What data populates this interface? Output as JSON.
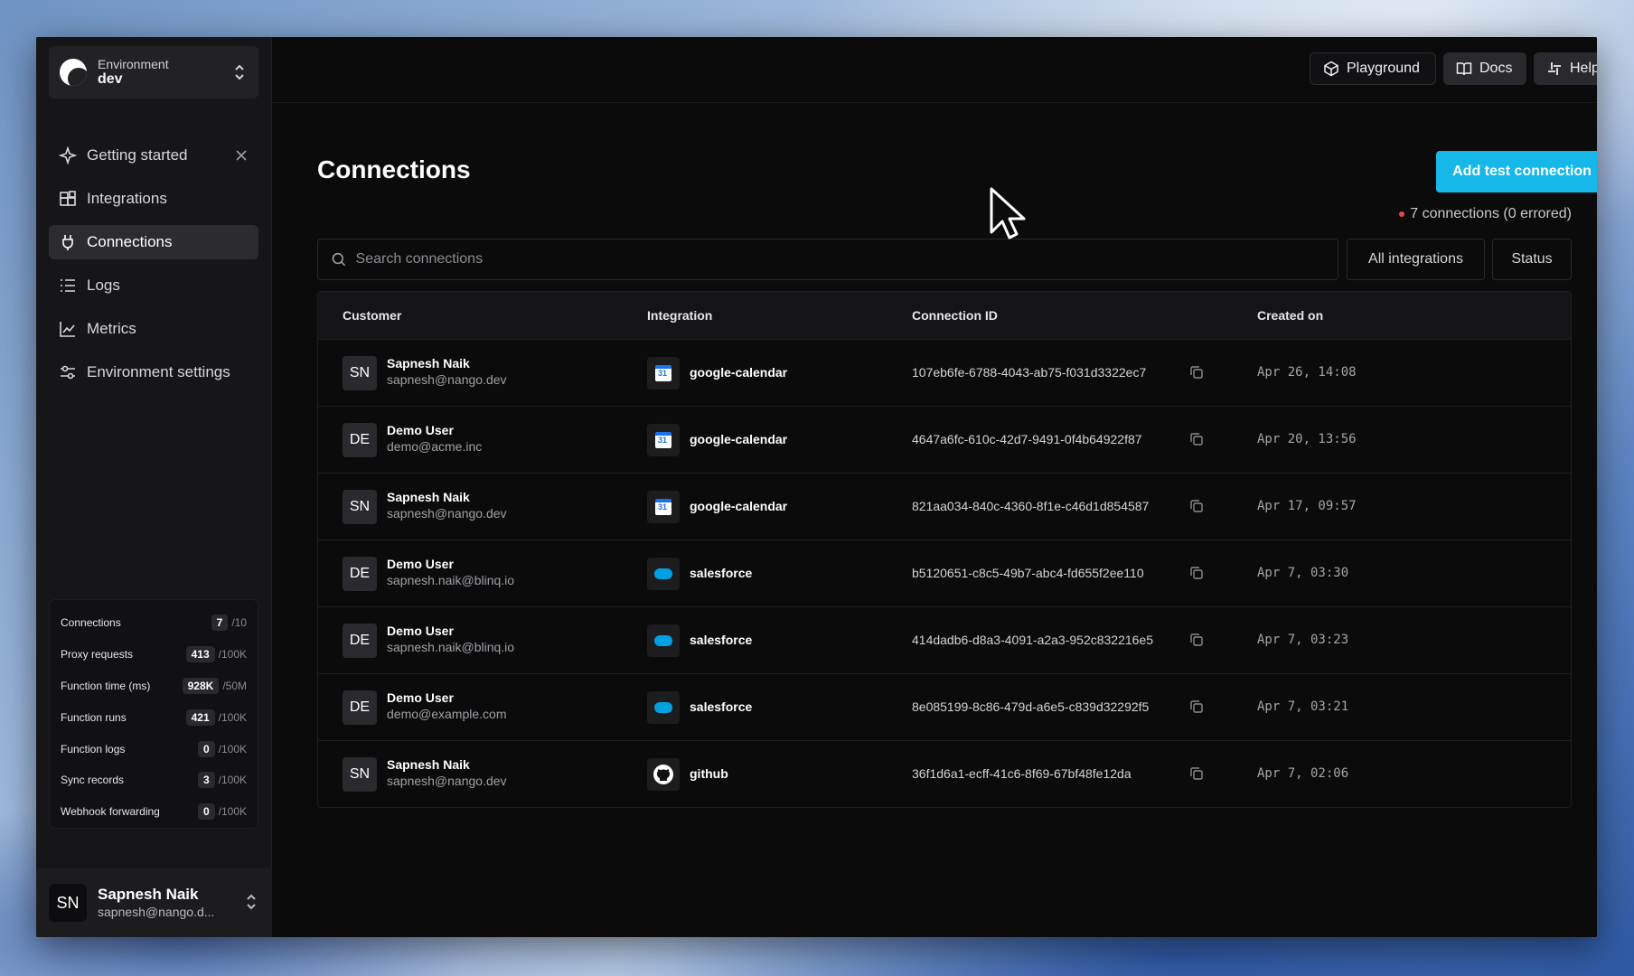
{
  "environment": {
    "label": "Environment",
    "value": "dev"
  },
  "sidebar": {
    "items": [
      {
        "label": "Getting started",
        "icon": "sparkle-icon"
      },
      {
        "label": "Integrations",
        "icon": "grid-icon"
      },
      {
        "label": "Connections",
        "icon": "plug-icon",
        "active": true
      },
      {
        "label": "Logs",
        "icon": "list-icon"
      },
      {
        "label": "Metrics",
        "icon": "chart-icon"
      },
      {
        "label": "Environment settings",
        "icon": "sliders-icon"
      }
    ]
  },
  "usage": [
    {
      "label": "Connections",
      "count": "7",
      "limit": "/10"
    },
    {
      "label": "Proxy requests",
      "count": "413",
      "limit": "/100K"
    },
    {
      "label": "Function time (ms)",
      "count": "928K",
      "limit": "/50M"
    },
    {
      "label": "Function runs",
      "count": "421",
      "limit": "/100K"
    },
    {
      "label": "Function logs",
      "count": "0",
      "limit": "/100K"
    },
    {
      "label": "Sync records",
      "count": "3",
      "limit": "/100K"
    },
    {
      "label": "Webhook forwarding",
      "count": "0",
      "limit": "/100K"
    }
  ],
  "user": {
    "initials": "SN",
    "name": "Sapnesh Naik",
    "email": "sapnesh@nango.d..."
  },
  "topbar": {
    "playground": "Playground",
    "docs": "Docs",
    "help": "Help"
  },
  "main": {
    "title": "Connections",
    "add_button": "Add test connection",
    "count_text": "7 connections (0 errored)",
    "search_placeholder": "Search connections",
    "filter_integrations": "All integrations",
    "filter_status": "Status"
  },
  "table": {
    "headers": {
      "customer": "Customer",
      "integration": "Integration",
      "connection_id": "Connection ID",
      "created_on": "Created on"
    },
    "rows": [
      {
        "initials": "SN",
        "name": "Sapnesh Naik",
        "email": "sapnesh@nango.dev",
        "integration": "google-calendar",
        "icon": "google-calendar-icon",
        "id": "107eb6fe-6788-4043-ab75-f031d3322ec7",
        "created": "Apr 26, 14:08"
      },
      {
        "initials": "DE",
        "name": "Demo User",
        "email": "demo@acme.inc",
        "integration": "google-calendar",
        "icon": "google-calendar-icon",
        "id": "4647a6fc-610c-42d7-9491-0f4b64922f87",
        "created": "Apr 20, 13:56"
      },
      {
        "initials": "SN",
        "name": "Sapnesh Naik",
        "email": "sapnesh@nango.dev",
        "integration": "google-calendar",
        "icon": "google-calendar-icon",
        "id": "821aa034-840c-4360-8f1e-c46d1d854587",
        "created": "Apr 17, 09:57"
      },
      {
        "initials": "DE",
        "name": "Demo User",
        "email": "sapnesh.naik@blinq.io",
        "integration": "salesforce",
        "icon": "salesforce-icon",
        "id": "b5120651-c8c5-49b7-abc4-fd655f2ee110",
        "created": "Apr 7, 03:30"
      },
      {
        "initials": "DE",
        "name": "Demo User",
        "email": "sapnesh.naik@blinq.io",
        "integration": "salesforce",
        "icon": "salesforce-icon",
        "id": "414dadb6-d8a3-4091-a2a3-952c832216e5",
        "created": "Apr 7, 03:23"
      },
      {
        "initials": "DE",
        "name": "Demo User",
        "email": "demo@example.com",
        "integration": "salesforce",
        "icon": "salesforce-icon",
        "id": "8e085199-8c86-479d-a6e5-c839d32292f5",
        "created": "Apr 7, 03:21"
      },
      {
        "initials": "SN",
        "name": "Sapnesh Naik",
        "email": "sapnesh@nango.dev",
        "integration": "github",
        "icon": "github-icon",
        "id": "36f1d6a1-ecff-41c6-8f69-67bf48fe12da",
        "created": "Apr 7, 02:06"
      }
    ]
  },
  "colors": {
    "accent": "#15b8e8",
    "error_dot": "#e5484d",
    "background": "#0b0b0c",
    "sidebar": "#161618"
  }
}
